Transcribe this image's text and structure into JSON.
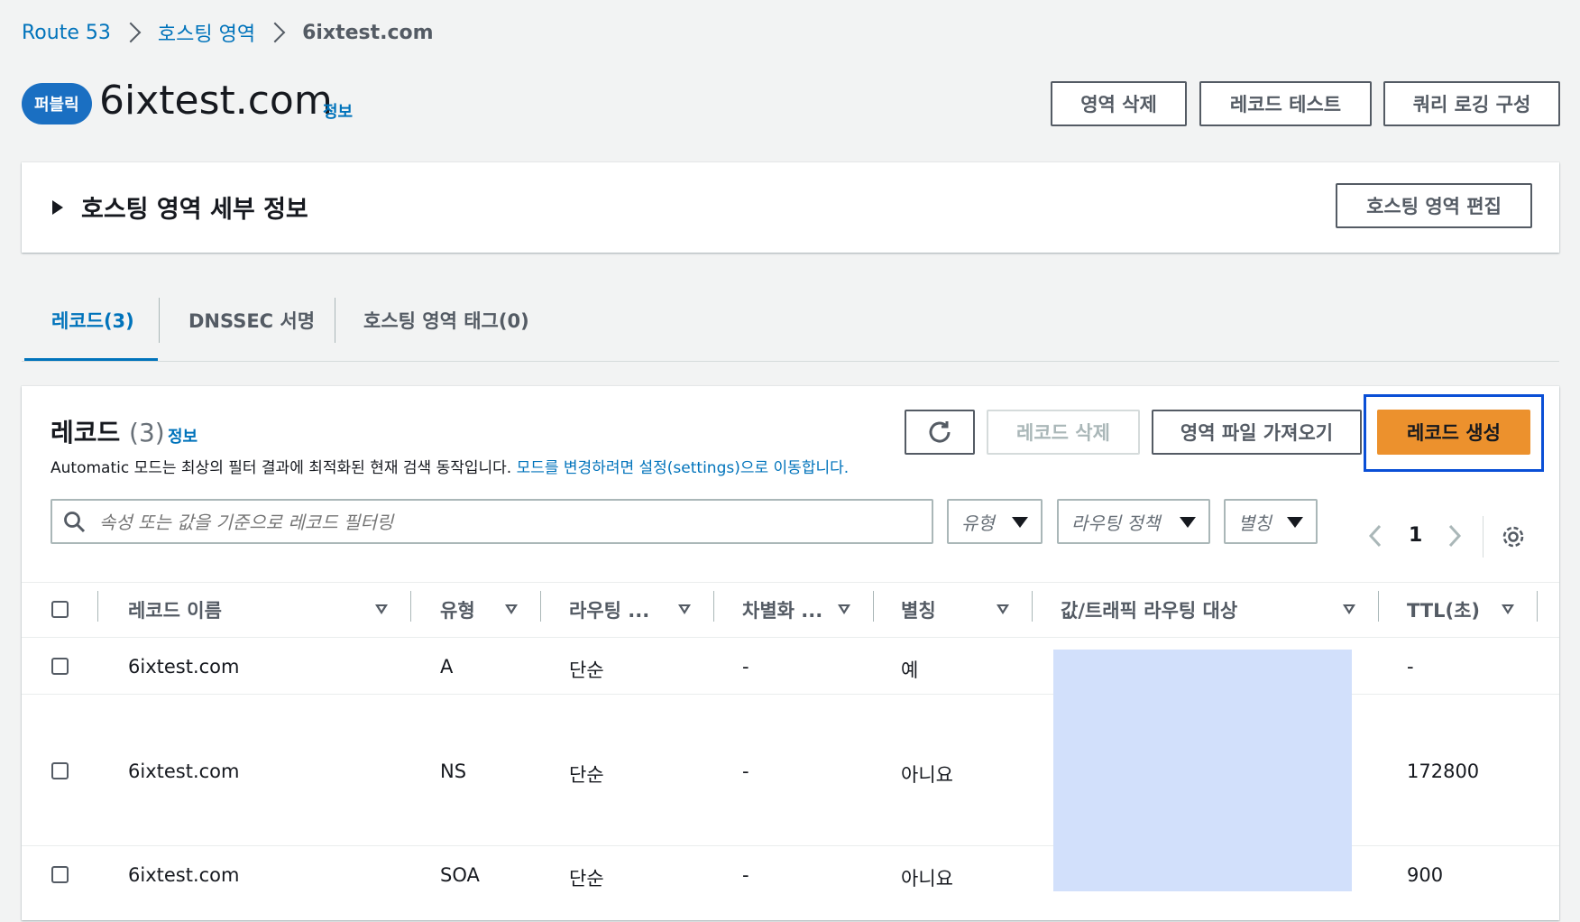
{
  "breadcrumb": {
    "items": [
      "Route 53",
      "호스팅 영역"
    ],
    "current": "6ixtest.com"
  },
  "header": {
    "badge": "퍼블릭",
    "title": "6ixtest.com",
    "info": "정보",
    "buttons": {
      "delete_zone": "영역 삭제",
      "test_record": "레코드 테스트",
      "query_logging": "쿼리 로깅 구성"
    }
  },
  "details": {
    "title": "호스팅 영역 세부 정보",
    "edit_button": "호스팅 영역 편집"
  },
  "tabs": [
    {
      "label": "레코드(3)",
      "active": true
    },
    {
      "label": "DNSSEC 서명"
    },
    {
      "label": "호스팅 영역 태그(0)"
    }
  ],
  "records": {
    "title": "레코드",
    "count": "(3)",
    "info": "정보",
    "description": "Automatic 모드는 최상의 필터 결과에 최적화된 현재 검색 동작입니다.",
    "description_link": "모드를 변경하려면 설정(settings)으로 이동합니다.",
    "buttons": {
      "refresh": "refresh-icon",
      "delete": "레코드 삭제",
      "import": "영역 파일 가져오기",
      "create": "레코드 생성"
    },
    "search_placeholder": "속성 또는 값을 기준으로 레코드 필터링",
    "filters": [
      "유형",
      "라우팅 정책",
      "별칭"
    ],
    "page": "1",
    "columns": [
      "레코드 이름",
      "유형",
      "라우팅 ...",
      "차별화 ...",
      "별칭",
      "값/트래픽 라우팅 대상",
      "TTL(초)"
    ],
    "rows": [
      {
        "name": "6ixtest.com",
        "type": "A",
        "routing": "단순",
        "diff": "-",
        "alias": "예",
        "ttl": "-"
      },
      {
        "name": "6ixtest.com",
        "type": "NS",
        "routing": "단순",
        "diff": "-",
        "alias": "아니요",
        "ttl": "172800"
      },
      {
        "name": "6ixtest.com",
        "type": "SOA",
        "routing": "단순",
        "diff": "-",
        "alias": "아니요",
        "ttl": "900"
      }
    ]
  },
  "colors": {
    "accent": "#0073bb",
    "primary_button": "#ec912d",
    "highlight_border": "#0a4fd6",
    "redaction": "#d2e0fb"
  }
}
